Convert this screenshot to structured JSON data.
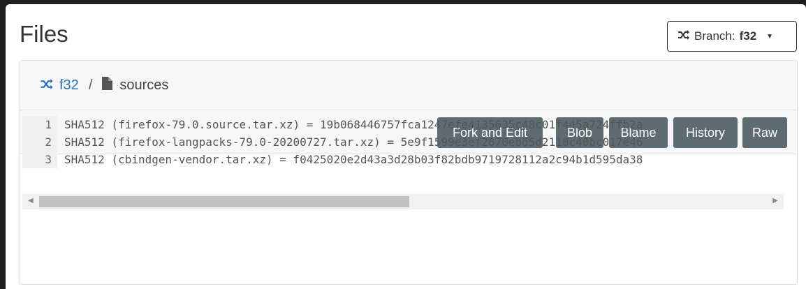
{
  "header": {
    "title": "Files",
    "branch_button": {
      "prefix": "Branch:",
      "value": "f32"
    }
  },
  "breadcrumb": {
    "branch": "f32",
    "separator": "/",
    "file": "sources"
  },
  "toolbar": {
    "fork_label": "Fork and Edit",
    "blob_label": "Blob",
    "blame_label": "Blame",
    "history_label": "History",
    "raw_label": "Raw"
  },
  "code": {
    "lines": [
      {
        "n": "1",
        "text": "SHA512 (firefox-79.0.source.tar.xz) = 19b068446757fca1247efe4135635c48c01f445a724ffb2a"
      },
      {
        "n": "2",
        "text": "SHA512 (firefox-langpacks-79.0-20200727.tar.xz) = 5e9f1599e3ef2670ebd5d2110c40bc017e46"
      },
      {
        "n": "3",
        "text": "SHA512 (cbindgen-vendor.tar.xz) = f0425020e2d43a3d28b03f82bdb9719728112a2c94b1d595da38"
      }
    ]
  },
  "colors": {
    "link": "#2a72b8",
    "button_bg": "#5f6b73"
  }
}
